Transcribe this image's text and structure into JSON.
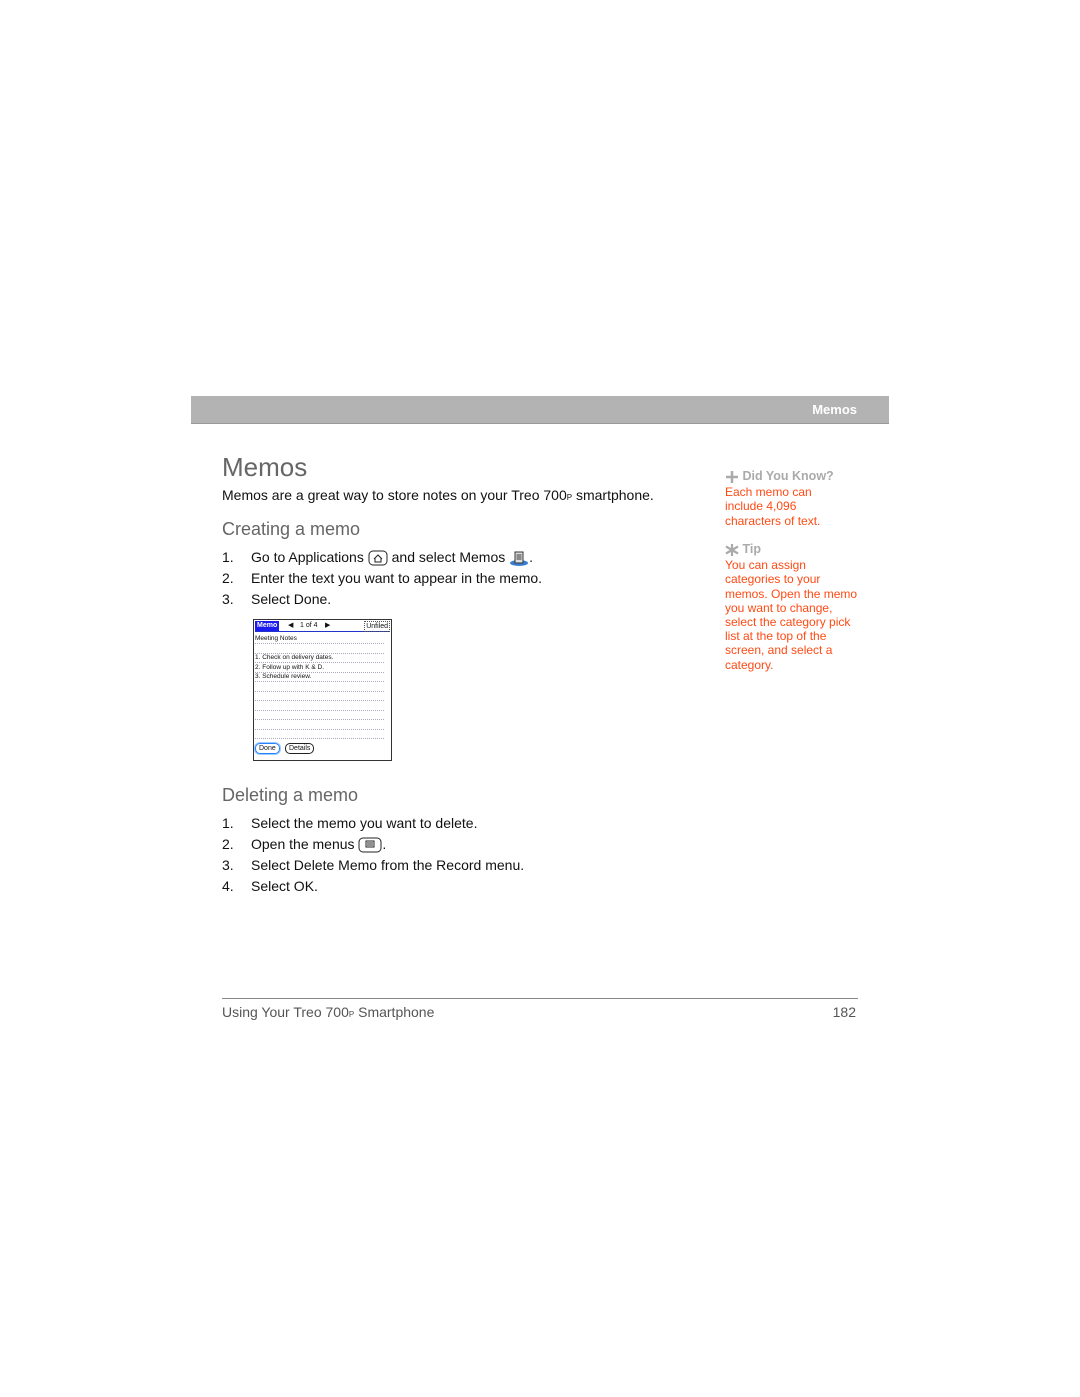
{
  "header": {
    "section": "Memos"
  },
  "title": "Memos",
  "intro": {
    "before": "Memos are a great way to store notes on your Treo 700",
    "suffix": "P",
    "after": " smartphone."
  },
  "creating": {
    "heading": "Creating a memo",
    "steps": [
      {
        "num": "1.",
        "a": "Go to Applications ",
        "b": " and select Memos ",
        "c": "."
      },
      {
        "num": "2.",
        "text": "Enter the text you want to appear in the memo."
      },
      {
        "num": "3.",
        "text": "Select Done."
      }
    ]
  },
  "screen": {
    "app": "Memo",
    "counter": "1 of 4",
    "category": "Unfiled",
    "lines": [
      "Meeting Notes",
      "",
      "1. Check on delivery dates.",
      "2. Follow up with K & D.",
      "3. Schedule review.",
      "",
      "",
      "",
      "",
      "",
      ""
    ],
    "done": "Done",
    "details": "Details"
  },
  "deleting": {
    "heading": "Deleting a memo",
    "steps": [
      {
        "num": "1.",
        "text": "Select the memo you want to delete."
      },
      {
        "num": "2.",
        "a": "Open the menus ",
        "c": "."
      },
      {
        "num": "3.",
        "text": "Select Delete Memo from the Record menu."
      },
      {
        "num": "4.",
        "text": "Select OK."
      }
    ]
  },
  "sidebar": {
    "did_you_know": {
      "heading": "Did You Know?",
      "body": "Each memo can include 4,096 characters of text."
    },
    "tip": {
      "heading": "Tip",
      "body": "You can assign categories to your memos. Open the memo you want to change, select the category pick list at the top of the screen, and select a category."
    }
  },
  "footer": {
    "before": "Using Your Treo 700",
    "suffix": "P",
    "after": " Smartphone",
    "page": "182"
  },
  "colors": {
    "accent": "#ff4a14",
    "header_bar": "#b3b3b3",
    "heading": "#666666"
  }
}
